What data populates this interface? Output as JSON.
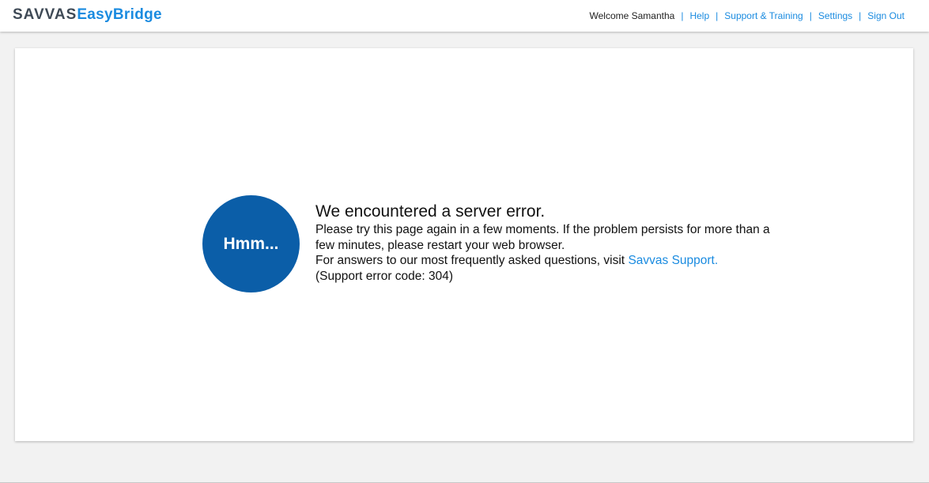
{
  "header": {
    "logo_brand": "SAVVAS",
    "logo_product": "EasyBridge",
    "welcome": "Welcome Samantha",
    "separator": "|",
    "nav": {
      "help": "Help",
      "support_training": "Support & Training",
      "settings": "Settings",
      "sign_out": "Sign Out"
    }
  },
  "error": {
    "badge": "Hmm...",
    "title": "We encountered a server error.",
    "line1": "Please try this page again in a few moments. If the problem persists for more than a few minutes, please restart your web browser.",
    "line2_prefix": "For answers to our most frequently asked questions, visit ",
    "support_link": "Savvas Support.",
    "code": "(Support error code: 304)"
  },
  "colors": {
    "accent": "#1a8be0",
    "badge_bg": "#0b5ea8",
    "brand_text": "#3f4a56",
    "page_bg": "#f2f2f2"
  }
}
